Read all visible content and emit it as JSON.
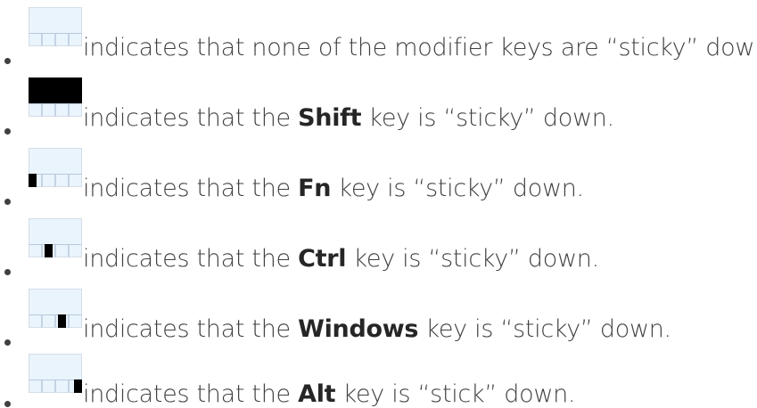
{
  "items": [
    {
      "icon": "sticky-keys-none-icon",
      "before": "indicates that",
      "key": "",
      "after": "none of the modifier keys are “sticky” down."
    },
    {
      "icon": "sticky-keys-shift-icon",
      "before": "indicates that the",
      "key": "Shift",
      "after": "key is “sticky” down."
    },
    {
      "icon": "sticky-keys-fn-icon",
      "before": "indicates that the",
      "key": "Fn",
      "after": "key is “sticky” down."
    },
    {
      "icon": "sticky-keys-ctrl-icon",
      "before": "indicates that the",
      "key": "Ctrl",
      "after": "key is “sticky” down."
    },
    {
      "icon": "sticky-keys-windows-icon",
      "before": "indicates that the",
      "key": "Windows",
      "after": "key is “sticky” down."
    },
    {
      "icon": "sticky-keys-alt-icon",
      "before": "indicates that the",
      "key": "Alt",
      "after": "key is “stick” down."
    }
  ],
  "colors": {
    "text": "#404040",
    "icon_fill": "#eaf4fc",
    "icon_border": "#b8c8dc",
    "active_key": "#000000"
  }
}
